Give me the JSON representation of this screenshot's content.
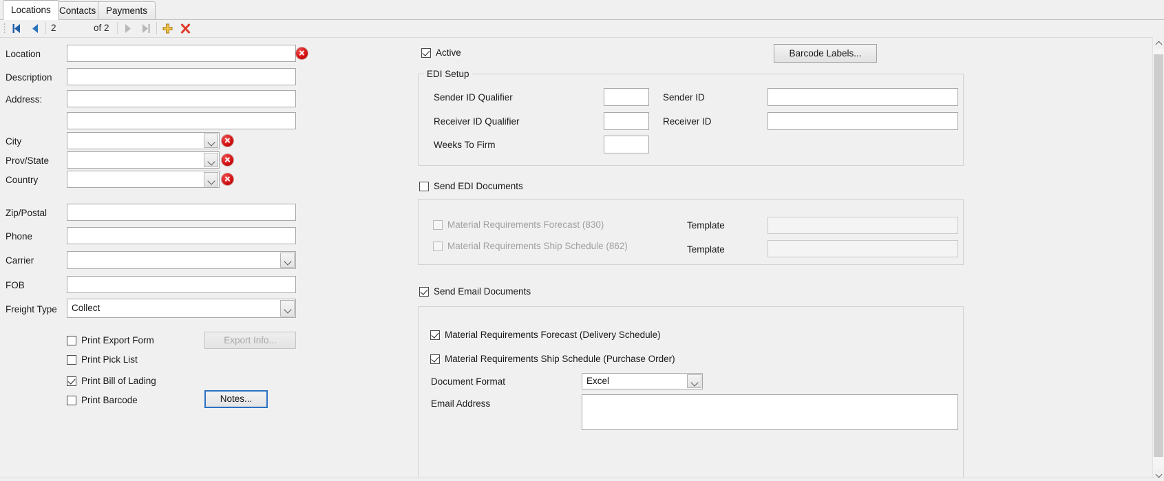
{
  "tabs": [
    {
      "label": "Locations",
      "active": true
    },
    {
      "label": "Contacts",
      "active": false
    },
    {
      "label": "Payments",
      "active": false
    }
  ],
  "navigator": {
    "first_icon": "first-record-icon",
    "prev_icon": "previous-record-icon",
    "next_icon": "next-record-icon",
    "last_icon": "last-record-icon",
    "add_icon": "add-record-icon",
    "delete_icon": "delete-record-icon",
    "current_page": "2",
    "of_label": "of 2",
    "total": "2"
  },
  "left": {
    "location": {
      "label": "Location",
      "value": "",
      "error": true
    },
    "description": {
      "label": "Description",
      "value": ""
    },
    "address": {
      "label": "Address:",
      "line1": "",
      "line2": ""
    },
    "city": {
      "label": "City",
      "value": "",
      "error": true
    },
    "prov_state": {
      "label": "Prov/State",
      "value": "",
      "error": true
    },
    "country": {
      "label": "Country",
      "value": "",
      "error": true
    },
    "zip_postal": {
      "label": "Zip/Postal",
      "value": ""
    },
    "phone": {
      "label": "Phone",
      "value": ""
    },
    "carrier": {
      "label": "Carrier",
      "value": ""
    },
    "fob": {
      "label": "FOB",
      "value": ""
    },
    "freight_type": {
      "label": "Freight Type",
      "value": "Collect"
    },
    "print_export_form": {
      "label": "Print Export Form",
      "checked": false
    },
    "print_pick_list": {
      "label": "Print Pick List",
      "checked": false
    },
    "print_bill_of_lading": {
      "label": "Print Bill of Lading",
      "checked": true
    },
    "print_barcode": {
      "label": "Print Barcode",
      "checked": false
    },
    "export_info_button": {
      "label": "Export Info...",
      "enabled": false
    },
    "notes_button": {
      "label": "Notes...",
      "focused": true
    }
  },
  "right": {
    "active": {
      "label": "Active",
      "checked": true
    },
    "barcode_labels_button": {
      "label": "Barcode Labels..."
    },
    "edi_setup": {
      "title": "EDI Setup",
      "sender_id_qualifier": {
        "label": "Sender ID Qualifier",
        "value": ""
      },
      "sender_id": {
        "label": "Sender ID",
        "value": ""
      },
      "receiver_id_qualifier": {
        "label": "Receiver ID Qualifier",
        "value": ""
      },
      "receiver_id": {
        "label": "Receiver ID",
        "value": ""
      },
      "weeks_to_firm": {
        "label": "Weeks To Firm",
        "value": ""
      }
    },
    "send_edi_documents": {
      "label": "Send EDI Documents",
      "checked": false
    },
    "edi_docs": {
      "forecast": {
        "label": "Material Requirements Forecast (830)",
        "checked": false,
        "enabled": false
      },
      "forecast_template": {
        "label": "Template",
        "value": "",
        "enabled": false
      },
      "ship_schedule": {
        "label": "Material Requirements Ship Schedule (862)",
        "checked": false,
        "enabled": false
      },
      "ship_schedule_template": {
        "label": "Template",
        "value": "",
        "enabled": false
      }
    },
    "send_email_documents": {
      "label": "Send Email Documents",
      "checked": true
    },
    "email_docs": {
      "forecast": {
        "label": "Material Requirements Forecast (Delivery Schedule)",
        "checked": true
      },
      "ship_schedule": {
        "label": "Material Requirements Ship Schedule (Purchase Order)",
        "checked": true
      },
      "document_format": {
        "label": "Document Format",
        "value": "Excel"
      },
      "email_address": {
        "label": "Email Address",
        "value": ""
      }
    }
  },
  "colors": {
    "window_bg": "#f0f0f0",
    "field_bg": "#ffffff",
    "error_red": "#d01010",
    "nav_blue": "#1f5fa8",
    "nav_disabled": "#b4b4b4",
    "add_gold": "#e8b33a",
    "delete_red": "#e03c2e",
    "focus_blue": "#2a72c4",
    "disabled_text": "#a0a0a0"
  }
}
